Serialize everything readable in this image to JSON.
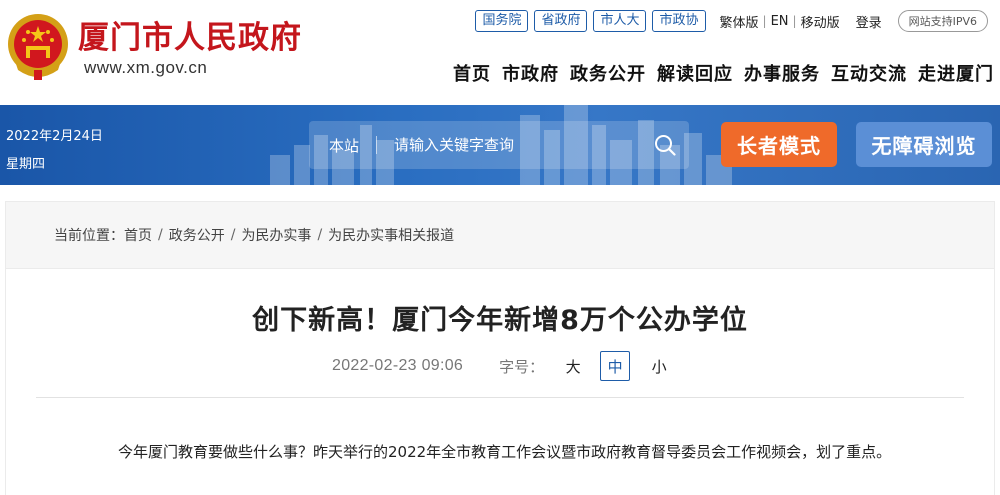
{
  "header": {
    "site_name": "厦门市人民政府",
    "site_url": "www.xm.gov.cn",
    "gov_links": [
      "国务院",
      "省政府",
      "市人大",
      "市政协"
    ],
    "utility_links": [
      "繁体版",
      "EN",
      "移动版"
    ],
    "login": "登录",
    "ipv6": "网站支持IPV6",
    "nav": [
      "首页",
      "市政府",
      "政务公开",
      "解读回应",
      "办事服务",
      "互动交流",
      "走进厦门"
    ]
  },
  "banner": {
    "date": "2022年2月24日",
    "weekday": "星期四",
    "search": {
      "scope": "本站",
      "placeholder": "请输入关键字查询"
    },
    "elder_mode": "长者模式",
    "accessibility": "无障碍浏览"
  },
  "breadcrumb": {
    "label": "当前位置：",
    "items": [
      "首页",
      "政务公开",
      "为民办实事",
      "为民办实事相关报道"
    ],
    "separator": "/"
  },
  "article": {
    "title": "创下新高！厦门今年新增8万个公办学位",
    "datetime": "2022-02-23 09:06",
    "font_size_label": "字号：",
    "font_sizes": [
      "大",
      "中",
      "小"
    ],
    "selected_size": "中",
    "paragraph": "今年厦门教育要做些什么事？昨天举行的2022年全市教育工作会议暨市政府教育督导委员会工作视频会，划了重点。"
  },
  "colors": {
    "brand_red": "#c4161c",
    "banner_blue": "#2a6ec1",
    "elder_orange": "#ef6a2a",
    "access_blue": "#5b8fd6",
    "link_blue": "#1e5ca8"
  }
}
